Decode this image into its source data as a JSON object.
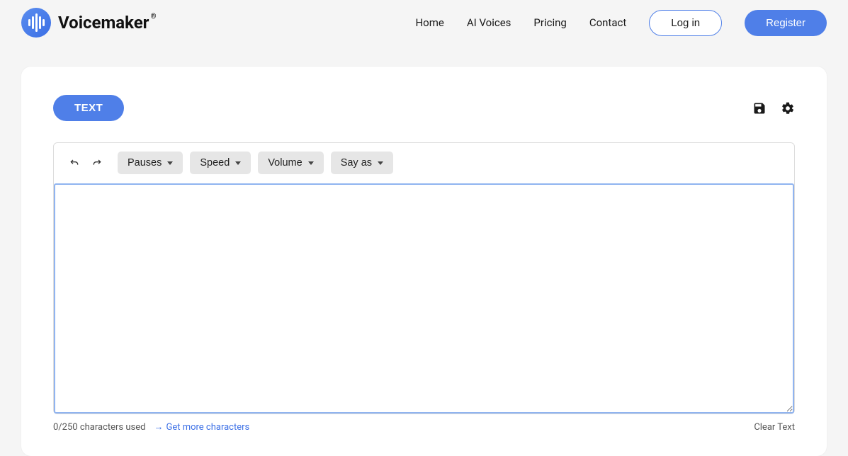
{
  "brand": {
    "name": "Voicemaker",
    "registered_symbol": "®"
  },
  "nav": {
    "items": [
      "Home",
      "AI Voices",
      "Pricing",
      "Contact"
    ],
    "login": "Log in",
    "register": "Register"
  },
  "editor": {
    "tab_label": "TEXT",
    "toolbar": {
      "pauses": "Pauses",
      "speed": "Speed",
      "volume": "Volume",
      "say_as": "Say as"
    },
    "textarea_value": ""
  },
  "footer": {
    "char_count": "0/250 characters used",
    "more_chars": "Get more characters",
    "clear": "Clear Text"
  }
}
